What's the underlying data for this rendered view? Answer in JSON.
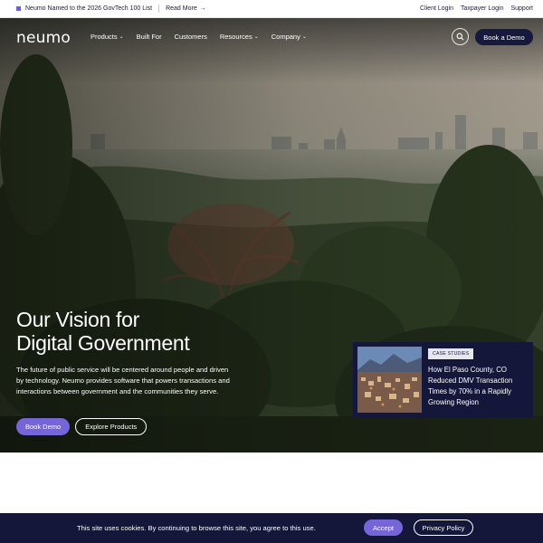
{
  "announcement": {
    "text": "Neumo Named to the 2026 GovTech 100 List",
    "link_label": "Read More",
    "utility_links": [
      "Client Login",
      "Taxpayer Login",
      "Support"
    ]
  },
  "nav": {
    "logo": "neumo",
    "menu": [
      {
        "label": "Products",
        "has_dropdown": true
      },
      {
        "label": "Built For",
        "has_dropdown": false
      },
      {
        "label": "Customers",
        "has_dropdown": false
      },
      {
        "label": "Resources",
        "has_dropdown": true
      },
      {
        "label": "Company",
        "has_dropdown": true
      }
    ],
    "search_icon": "search-icon",
    "cta_label": "Book a Demo"
  },
  "hero": {
    "headline_line1": "Our Vision for",
    "headline_line2": "Digital Government",
    "lede": "The future of public service will be centered around people and driven by technology. Neumo provides software that powers transactions and interactions between government and the communities they serve.",
    "primary_cta": "Book Demo",
    "secondary_cta": "Explore Products",
    "carousel": {
      "slide_count": 4,
      "active_index": 0,
      "next_icon": "arrow-right-icon"
    },
    "card": {
      "tag": "CASE STUDIES",
      "title": "How El Paso County, CO Reduced DMV Transaction Times by 70% in a Rapidly Growing Region"
    }
  },
  "cookie_banner": {
    "text": "This site uses cookies. By continuing to browse this site, you agree to this use.",
    "accept_label": "Accept",
    "privacy_label": "Privacy Policy"
  },
  "colors": {
    "accent": "#7565d8",
    "navy": "#16183c",
    "announcement_square": "#6c5ce7"
  }
}
